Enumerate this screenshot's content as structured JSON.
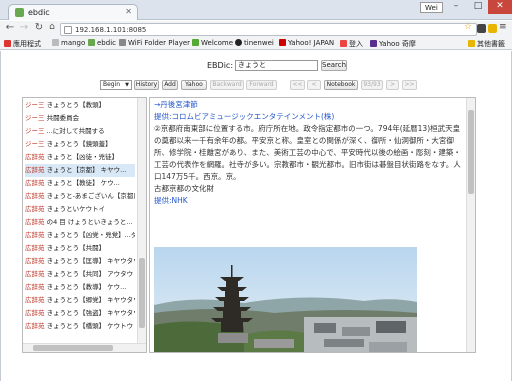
{
  "browser": {
    "tab_title": "ebdic",
    "url": "192.168.1.101:8085",
    "user_badge": "Wei"
  },
  "bookmarks": [
    {
      "label": "應用程式",
      "icon": "apps-grid-icon",
      "color": "#d33"
    },
    {
      "label": "mango",
      "icon": "page-icon",
      "color": "#999"
    },
    {
      "label": "ebdic",
      "icon": "ebdic-icon",
      "color": "#6aa84f"
    },
    {
      "label": "WiFi Folder Player",
      "icon": "folder-icon",
      "color": "#888"
    },
    {
      "label": "Welcome",
      "icon": "welcome-icon",
      "color": "#5a3"
    },
    {
      "label": "tinenwei",
      "icon": "github-icon",
      "color": "#222"
    },
    {
      "label": "Yahoo! JAPAN",
      "icon": "yahoo-icon",
      "color": "#c00"
    },
    {
      "label": "登入",
      "icon": "login-icon",
      "color": "#e44"
    },
    {
      "label": "Yahoo 奇摩",
      "icon": "yahoo-icon",
      "color": "#5a2d91"
    },
    {
      "label": "其他書籤",
      "icon": "folder-icon",
      "color": "#e8b500"
    }
  ],
  "search": {
    "label": "EBDic:",
    "value": "きょうと",
    "button": "Search"
  },
  "controls": {
    "select_value": "Begin",
    "buttons": [
      "History",
      "Add",
      "Yahoo",
      "Backward",
      "Forward"
    ],
    "pager": [
      "<<",
      "<",
      "Notebook",
      "93/93",
      ">",
      ">>"
    ]
  },
  "list": [
    {
      "tag": "ジー三",
      "text": "きょうとう【教頭】"
    },
    {
      "tag": "ジー三",
      "text": "共闘委員会"
    },
    {
      "tag": "ジー三",
      "text": "...に対して共闘する"
    },
    {
      "tag": "ジー三",
      "text": "きょうとう【鏡頭蓋】"
    },
    {
      "tag": "広辞苑",
      "text": "きょうと【凶徒・兇徒】"
    },
    {
      "tag": "広辞苑",
      "text": "きょうと【京都】 キヤウ..."
    },
    {
      "tag": "広辞苑",
      "text": "きょうと【教徒】 ケウ..."
    },
    {
      "tag": "広辞苑",
      "text": "きょうと-あまございん【京都尼五山】"
    },
    {
      "tag": "広辞苑",
      "text": "きょうといケウトイ"
    },
    {
      "tag": "広辞苑",
      "text": "の4 目 けょうといきょうと..."
    },
    {
      "tag": "広辞苑",
      "text": "きょうとう【凶党・兇党】...ダウ"
    },
    {
      "tag": "広辞苑",
      "text": "きょうとう【共闘】"
    },
    {
      "tag": "広辞苑",
      "text": "きょうとう【匡導】 キヤウタウ"
    },
    {
      "tag": "広辞苑",
      "text": "きょうとう【共同】 アウタウ"
    },
    {
      "tag": "広辞苑",
      "text": "きょうとう【教導】 ケウ..."
    },
    {
      "tag": "広辞苑",
      "text": "きょうとう【郷党】 キヤウタウ"
    },
    {
      "tag": "広辞苑",
      "text": "きょうとう【強盗】 キヤウタウ"
    },
    {
      "tag": "広辞苑",
      "text": "きょうとう【橋頭】 ケウトウ"
    }
  ],
  "detail": {
    "link1": "→丹後宮津節",
    "link2": "提供:コロムビアミュージックエンタテインメント(株)",
    "body": "②京都府南東部に位置する市。府庁所在地。政令指定都市の一つ。794年(延暦13)桓武天皇の奠都以来一千有余年の都。平安京と称。皇室との関係が深く、御所・仙洞御所・大宮御所、修学院・桂離宮があり、また、美術工芸の中心で、平安時代以後の絵画・彫刻・建築・工芸の代表作を網羅。社寺が多い。宗教都市・観光都市。旧市街は碁盤目状街路をなす。人口147万5千。西京。京。",
    "caption": "古都京都の文化財",
    "credit": "提供:NHK"
  }
}
